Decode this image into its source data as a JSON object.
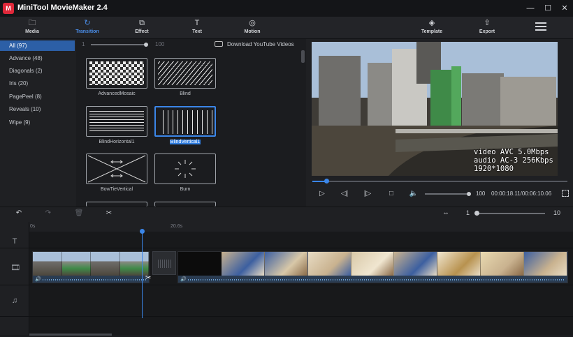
{
  "window": {
    "title": "MiniTool MovieMaker 2.4",
    "logo_glyph": "M",
    "controls": [
      "—",
      "☐",
      "✕"
    ]
  },
  "toolbar": {
    "tabs": [
      {
        "label": "Media",
        "icon": "folder-icon",
        "glyph": "🗀"
      },
      {
        "label": "Transition",
        "icon": "transition-icon",
        "glyph": "↻",
        "active": true
      },
      {
        "label": "Effect",
        "icon": "effect-icon",
        "glyph": "⧉"
      },
      {
        "label": "Text",
        "icon": "text-icon",
        "glyph": "T"
      },
      {
        "label": "Motion",
        "icon": "motion-icon",
        "glyph": "◎"
      }
    ],
    "template_label": "Template",
    "template_glyph": "◈",
    "export_label": "Export",
    "export_glyph": "⇧"
  },
  "sidebar": {
    "items": [
      {
        "label": "All",
        "count": "(97)",
        "active": true
      },
      {
        "label": "Advance",
        "count": "(48)"
      },
      {
        "label": "Diagonals",
        "count": "(2)"
      },
      {
        "label": "Iris",
        "count": "(20)"
      },
      {
        "label": "PagePeel",
        "count": "(8)"
      },
      {
        "label": "Reveals",
        "count": "(10)"
      },
      {
        "label": "Wipe",
        "count": "(9)"
      }
    ]
  },
  "transitions_panel": {
    "slider_min": "1",
    "slider_max": "100",
    "download_label": "Download YouTube Videos",
    "items": [
      {
        "label": "AdvancedMosaic"
      },
      {
        "label": "Blind"
      },
      {
        "label": "BlindHorizontal1"
      },
      {
        "label": "BlindVertical1",
        "selected": true
      },
      {
        "label": "BowTieVertical"
      },
      {
        "label": "Burn"
      }
    ]
  },
  "preview": {
    "osd_lines": "video AVC 5.0Mbps\naudio AC-3 256Kbps\n1920*1080",
    "playback_progress": 0.055,
    "volume_value": "100",
    "volume_level": 0.95,
    "timecode": "00:00:18.11/00:06:10.06",
    "buttons": {
      "play": "▷",
      "prev_frame": "◁|",
      "next_frame": "|▷",
      "stop": "□",
      "volume": "🔈",
      "fullscreen": "⛶"
    }
  },
  "timeline_toolbar": {
    "undo": "↶",
    "redo": "↷",
    "delete": "🗑",
    "split": "✂",
    "fit": "⇔",
    "zoom_min": "1",
    "zoom_max": "10",
    "zoom_level": 0.0
  },
  "timeline": {
    "ruler_labels": [
      "0s",
      "20.6s"
    ],
    "track_icons": {
      "text": "T",
      "video": "🎞",
      "audio": "♫"
    },
    "clip1_speaker": "🔊",
    "clip2_speaker": "🔊",
    "scissor": "✂"
  },
  "colors": {
    "accent": "#3b86e8",
    "sidebar_active": "#2c5fa6",
    "background": "#1b1c1f"
  }
}
